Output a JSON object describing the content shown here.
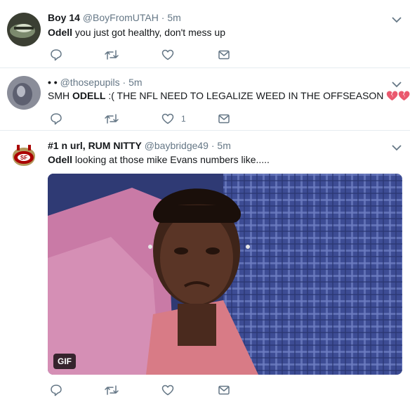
{
  "tweets": [
    {
      "name": "Boy 14",
      "handle": "@BoyFromUTAH",
      "time": "5m",
      "text_bold": "Odell",
      "text_rest": " you just got healthy, don't mess up",
      "like_count": ""
    },
    {
      "name": "• •",
      "handle": "@thosepupils",
      "time": "5m",
      "text_prefix": "SMH ",
      "text_bold": "ODELL",
      "text_rest": " :( THE NFL NEED TO LEGALIZE WEED IN THE OFFSEASON",
      "like_count": "1"
    },
    {
      "name": "#1 n url, RUM NITTY",
      "handle": "@baybridge49",
      "time": "5m",
      "text_bold": "Odell",
      "text_rest": " looking at those mike Evans numbers like.....",
      "media_badge": "GIF",
      "like_count": ""
    }
  ],
  "separator": "·",
  "icons": [
    "reply-icon",
    "retweet-icon",
    "like-icon",
    "message-icon",
    "caret-down-icon",
    "broken-heart-icon"
  ],
  "colors": {
    "name": "#14171a",
    "muted": "#657786",
    "divider": "#e6ecf0",
    "caret": "#657786"
  }
}
